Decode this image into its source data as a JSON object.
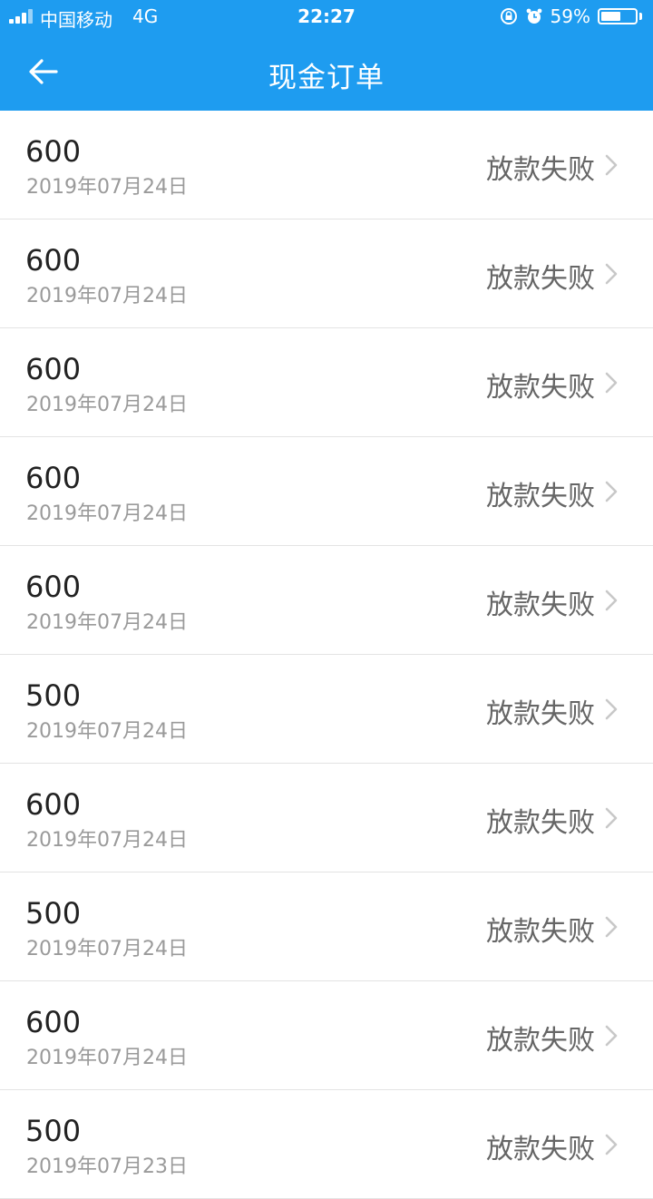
{
  "status_bar": {
    "carrier": "中国移动",
    "network": "4G",
    "time": "22:27",
    "battery_percent": "59%",
    "battery_level": 0.59
  },
  "header": {
    "title": "现金订单",
    "back_icon": "arrow-left-icon"
  },
  "colors": {
    "primary": "#1E9CF0",
    "amount_text": "#222222",
    "date_text": "#9A9A9A",
    "status_text": "#666666",
    "divider": "#E3E3E3"
  },
  "orders": [
    {
      "amount": "600",
      "date": "2019年07月24日",
      "status": "放款失败"
    },
    {
      "amount": "600",
      "date": "2019年07月24日",
      "status": "放款失败"
    },
    {
      "amount": "600",
      "date": "2019年07月24日",
      "status": "放款失败"
    },
    {
      "amount": "600",
      "date": "2019年07月24日",
      "status": "放款失败"
    },
    {
      "amount": "600",
      "date": "2019年07月24日",
      "status": "放款失败"
    },
    {
      "amount": "500",
      "date": "2019年07月24日",
      "status": "放款失败"
    },
    {
      "amount": "600",
      "date": "2019年07月24日",
      "status": "放款失败"
    },
    {
      "amount": "500",
      "date": "2019年07月24日",
      "status": "放款失败"
    },
    {
      "amount": "600",
      "date": "2019年07月24日",
      "status": "放款失败"
    },
    {
      "amount": "500",
      "date": "2019年07月23日",
      "status": "放款失败"
    }
  ]
}
